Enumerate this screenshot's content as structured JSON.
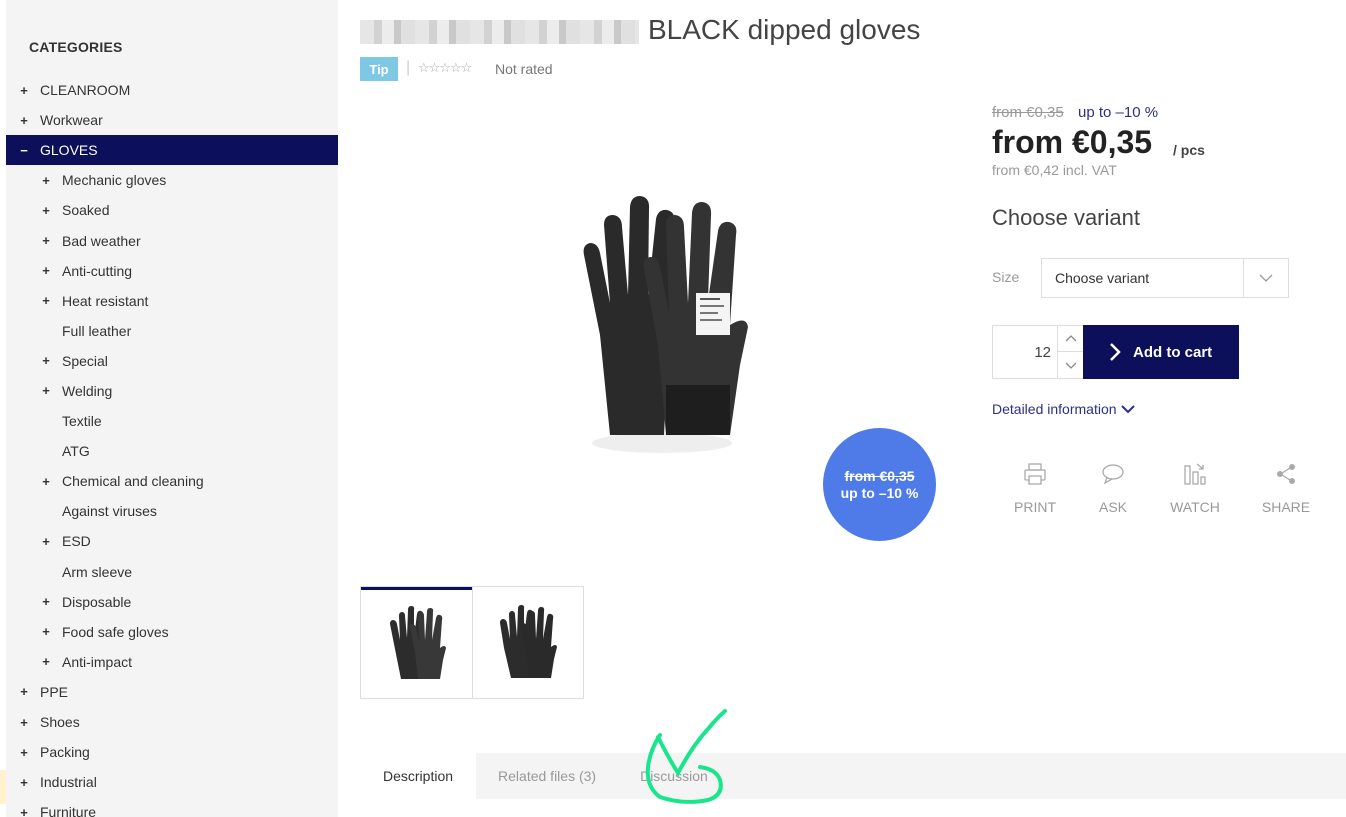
{
  "sidebar": {
    "heading": "CATEGORIES",
    "items": [
      {
        "label": "CLEANROOM",
        "sign": "+"
      },
      {
        "label": "Workwear",
        "sign": "+"
      },
      {
        "label": "GLOVES",
        "sign": "−"
      },
      {
        "label": "Mechanic gloves",
        "sign": "+"
      },
      {
        "label": "Soaked",
        "sign": "+"
      },
      {
        "label": "Bad weather",
        "sign": "+"
      },
      {
        "label": "Anti-cutting",
        "sign": "+"
      },
      {
        "label": "Heat resistant",
        "sign": "+"
      },
      {
        "label": "Full leather",
        "sign": ""
      },
      {
        "label": "Special",
        "sign": "+"
      },
      {
        "label": "Welding",
        "sign": "+"
      },
      {
        "label": "Textile",
        "sign": ""
      },
      {
        "label": "ATG",
        "sign": ""
      },
      {
        "label": "Chemical and cleaning",
        "sign": "+"
      },
      {
        "label": "Against viruses",
        "sign": ""
      },
      {
        "label": "ESD",
        "sign": "+"
      },
      {
        "label": "Arm sleeve",
        "sign": ""
      },
      {
        "label": "Disposable",
        "sign": "+"
      },
      {
        "label": "Food safe gloves",
        "sign": "+"
      },
      {
        "label": "Anti-impact",
        "sign": "+"
      },
      {
        "label": "PPE",
        "sign": "+"
      },
      {
        "label": "Shoes",
        "sign": "+"
      },
      {
        "label": "Packing",
        "sign": "+"
      },
      {
        "label": "Industrial",
        "sign": "+"
      },
      {
        "label": "Furniture",
        "sign": "+"
      }
    ]
  },
  "product": {
    "title": "BLACK dipped gloves",
    "tip_badge": "Tip",
    "separator": "|",
    "stars": "☆☆☆☆☆",
    "rating_text": "Not rated",
    "discount_badge": {
      "old": "from €0,35",
      "discount": "up to –10 %"
    }
  },
  "pricing": {
    "old_price": "from €0,35",
    "discount_text": "up to –10 %",
    "price": "from €0,35",
    "unit": "/ pcs",
    "vat_price": "from €0,42 incl. VAT"
  },
  "variant": {
    "heading": "Choose variant",
    "size_label": "Size",
    "select_value": "Choose variant"
  },
  "cart": {
    "quantity": "12",
    "add_label": "Add to cart"
  },
  "detail_link": "Detailed information",
  "actions": [
    {
      "label": "PRINT",
      "icon": "print-icon"
    },
    {
      "label": "ASK",
      "icon": "chat-bubble-icon"
    },
    {
      "label": "WATCH",
      "icon": "watch-chart-icon"
    },
    {
      "label": "SHARE",
      "icon": "share-icon"
    }
  ],
  "tabs": [
    {
      "label": "Description",
      "active": true
    },
    {
      "label": "Related files (3)",
      "active": false
    },
    {
      "label": "Discussion",
      "active": false
    }
  ],
  "colors": {
    "accent": "#0c0f5a",
    "badge_blue": "#4f7be8",
    "tip_badge": "#7ec8e3",
    "link": "#2b2f8a",
    "scribble": "#19e68c"
  }
}
